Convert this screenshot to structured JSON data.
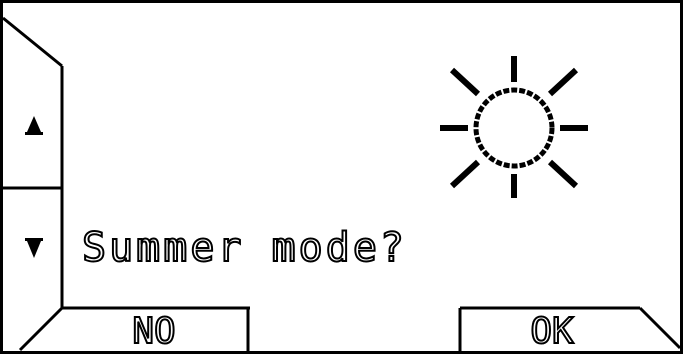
{
  "dialog": {
    "prompt": "Summer mode?",
    "icon": "sun-icon"
  },
  "nav": {
    "up_icon": "arrow-up-icon",
    "down_icon": "arrow-down-icon"
  },
  "buttons": {
    "no_label": "NO",
    "ok_label": "OK"
  },
  "colors": {
    "foreground": "#000000",
    "background": "#ffffff"
  }
}
